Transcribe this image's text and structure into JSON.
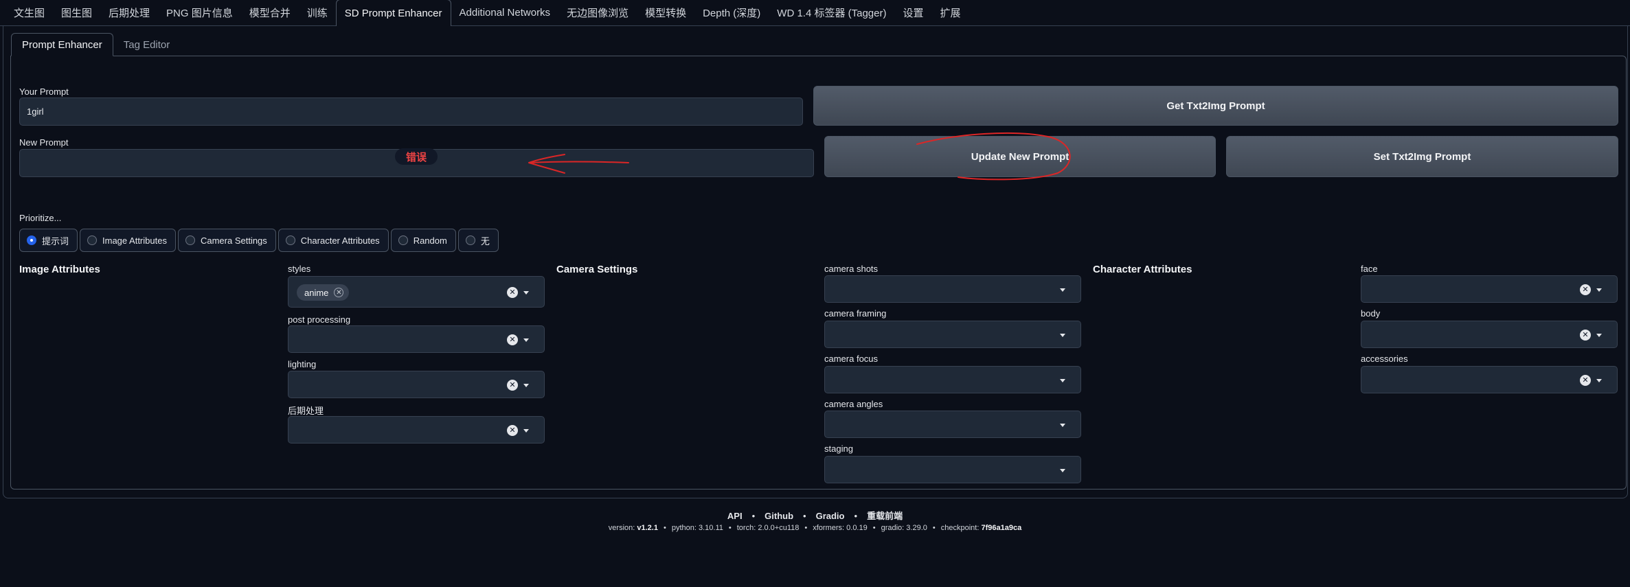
{
  "top_tabs": [
    "文生图",
    "图生图",
    "后期处理",
    "PNG 图片信息",
    "模型合并",
    "训练",
    "SD Prompt Enhancer",
    "Additional Networks",
    "无边图像浏览",
    "模型转换",
    "Depth (深度)",
    "WD 1.4 标签器 (Tagger)",
    "设置",
    "扩展"
  ],
  "active_top_tab": "SD Prompt Enhancer",
  "sub_tabs": [
    "Prompt Enhancer",
    "Tag Editor"
  ],
  "your_prompt": {
    "label": "Your Prompt",
    "value": "1girl"
  },
  "new_prompt": {
    "label": "New Prompt",
    "value": "",
    "error": "错误"
  },
  "buttons": {
    "get_txt2img": "Get Txt2Img Prompt",
    "update_new": "Update New Prompt",
    "set_txt2img": "Set Txt2Img Prompt"
  },
  "prioritize": {
    "label": "Prioritize...",
    "options": [
      "提示词",
      "Image Attributes",
      "Camera Settings",
      "Character Attributes",
      "Random",
      "无"
    ],
    "selected": "提示词"
  },
  "image_attributes": {
    "title": "Image Attributes",
    "fields": [
      {
        "label": "styles",
        "chips": [
          "anime"
        ]
      },
      {
        "label": "post processing",
        "chips": []
      },
      {
        "label": "lighting",
        "chips": []
      },
      {
        "label": "后期处理",
        "chips": []
      }
    ]
  },
  "camera_settings": {
    "title": "Camera Settings",
    "fields": [
      "camera shots",
      "camera framing",
      "camera focus",
      "camera angles",
      "staging"
    ]
  },
  "character_attributes": {
    "title": "Character Attributes",
    "fields": [
      "face",
      "body",
      "accessories"
    ]
  },
  "footer": {
    "links": [
      "API",
      "Github",
      "Gradio",
      "重载前端"
    ],
    "version": {
      "version_label": "version:",
      "version": "v1.2.1",
      "python_label": "python:",
      "python": "3.10.11",
      "torch_label": "torch:",
      "torch": "2.0.0+cu118",
      "xformers_label": "xformers:",
      "xformers": "0.0.19",
      "gradio_label": "gradio:",
      "gradio": "3.29.0",
      "checkpoint_label": "checkpoint:",
      "checkpoint": "7f96a1a9ca"
    }
  },
  "colors": {
    "background": "#0b0f19",
    "error": "#ef4444",
    "radio_checked": "#2563eb",
    "annotation": "#dc2626"
  }
}
